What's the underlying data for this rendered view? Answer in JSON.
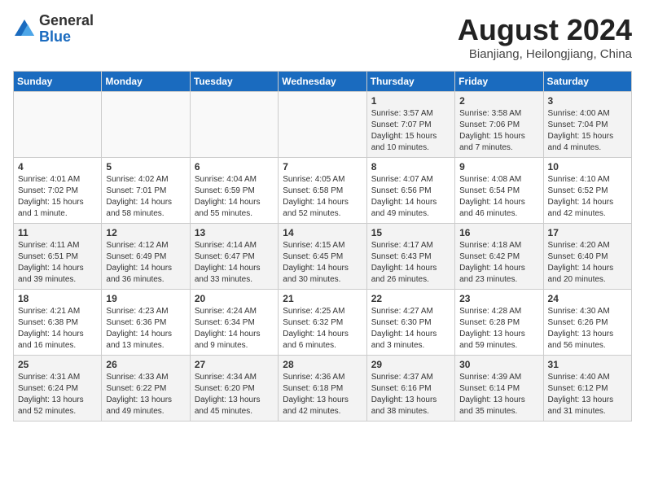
{
  "header": {
    "logo_general": "General",
    "logo_blue": "Blue",
    "title": "August 2024",
    "subtitle": "Bianjiang, Heilongjiang, China"
  },
  "weekdays": [
    "Sunday",
    "Monday",
    "Tuesday",
    "Wednesday",
    "Thursday",
    "Friday",
    "Saturday"
  ],
  "weeks": [
    [
      {
        "day": "",
        "empty": true
      },
      {
        "day": "",
        "empty": true
      },
      {
        "day": "",
        "empty": true
      },
      {
        "day": "",
        "empty": true
      },
      {
        "day": "1",
        "info": "Sunrise: 3:57 AM\nSunset: 7:07 PM\nDaylight: 15 hours\nand 10 minutes."
      },
      {
        "day": "2",
        "info": "Sunrise: 3:58 AM\nSunset: 7:06 PM\nDaylight: 15 hours\nand 7 minutes."
      },
      {
        "day": "3",
        "info": "Sunrise: 4:00 AM\nSunset: 7:04 PM\nDaylight: 15 hours\nand 4 minutes."
      }
    ],
    [
      {
        "day": "4",
        "info": "Sunrise: 4:01 AM\nSunset: 7:02 PM\nDaylight: 15 hours\nand 1 minute."
      },
      {
        "day": "5",
        "info": "Sunrise: 4:02 AM\nSunset: 7:01 PM\nDaylight: 14 hours\nand 58 minutes."
      },
      {
        "day": "6",
        "info": "Sunrise: 4:04 AM\nSunset: 6:59 PM\nDaylight: 14 hours\nand 55 minutes."
      },
      {
        "day": "7",
        "info": "Sunrise: 4:05 AM\nSunset: 6:58 PM\nDaylight: 14 hours\nand 52 minutes."
      },
      {
        "day": "8",
        "info": "Sunrise: 4:07 AM\nSunset: 6:56 PM\nDaylight: 14 hours\nand 49 minutes."
      },
      {
        "day": "9",
        "info": "Sunrise: 4:08 AM\nSunset: 6:54 PM\nDaylight: 14 hours\nand 46 minutes."
      },
      {
        "day": "10",
        "info": "Sunrise: 4:10 AM\nSunset: 6:52 PM\nDaylight: 14 hours\nand 42 minutes."
      }
    ],
    [
      {
        "day": "11",
        "info": "Sunrise: 4:11 AM\nSunset: 6:51 PM\nDaylight: 14 hours\nand 39 minutes."
      },
      {
        "day": "12",
        "info": "Sunrise: 4:12 AM\nSunset: 6:49 PM\nDaylight: 14 hours\nand 36 minutes."
      },
      {
        "day": "13",
        "info": "Sunrise: 4:14 AM\nSunset: 6:47 PM\nDaylight: 14 hours\nand 33 minutes."
      },
      {
        "day": "14",
        "info": "Sunrise: 4:15 AM\nSunset: 6:45 PM\nDaylight: 14 hours\nand 30 minutes."
      },
      {
        "day": "15",
        "info": "Sunrise: 4:17 AM\nSunset: 6:43 PM\nDaylight: 14 hours\nand 26 minutes."
      },
      {
        "day": "16",
        "info": "Sunrise: 4:18 AM\nSunset: 6:42 PM\nDaylight: 14 hours\nand 23 minutes."
      },
      {
        "day": "17",
        "info": "Sunrise: 4:20 AM\nSunset: 6:40 PM\nDaylight: 14 hours\nand 20 minutes."
      }
    ],
    [
      {
        "day": "18",
        "info": "Sunrise: 4:21 AM\nSunset: 6:38 PM\nDaylight: 14 hours\nand 16 minutes."
      },
      {
        "day": "19",
        "info": "Sunrise: 4:23 AM\nSunset: 6:36 PM\nDaylight: 14 hours\nand 13 minutes."
      },
      {
        "day": "20",
        "info": "Sunrise: 4:24 AM\nSunset: 6:34 PM\nDaylight: 14 hours\nand 9 minutes."
      },
      {
        "day": "21",
        "info": "Sunrise: 4:25 AM\nSunset: 6:32 PM\nDaylight: 14 hours\nand 6 minutes."
      },
      {
        "day": "22",
        "info": "Sunrise: 4:27 AM\nSunset: 6:30 PM\nDaylight: 14 hours\nand 3 minutes."
      },
      {
        "day": "23",
        "info": "Sunrise: 4:28 AM\nSunset: 6:28 PM\nDaylight: 13 hours\nand 59 minutes."
      },
      {
        "day": "24",
        "info": "Sunrise: 4:30 AM\nSunset: 6:26 PM\nDaylight: 13 hours\nand 56 minutes."
      }
    ],
    [
      {
        "day": "25",
        "info": "Sunrise: 4:31 AM\nSunset: 6:24 PM\nDaylight: 13 hours\nand 52 minutes."
      },
      {
        "day": "26",
        "info": "Sunrise: 4:33 AM\nSunset: 6:22 PM\nDaylight: 13 hours\nand 49 minutes."
      },
      {
        "day": "27",
        "info": "Sunrise: 4:34 AM\nSunset: 6:20 PM\nDaylight: 13 hours\nand 45 minutes."
      },
      {
        "day": "28",
        "info": "Sunrise: 4:36 AM\nSunset: 6:18 PM\nDaylight: 13 hours\nand 42 minutes."
      },
      {
        "day": "29",
        "info": "Sunrise: 4:37 AM\nSunset: 6:16 PM\nDaylight: 13 hours\nand 38 minutes."
      },
      {
        "day": "30",
        "info": "Sunrise: 4:39 AM\nSunset: 6:14 PM\nDaylight: 13 hours\nand 35 minutes."
      },
      {
        "day": "31",
        "info": "Sunrise: 4:40 AM\nSunset: 6:12 PM\nDaylight: 13 hours\nand 31 minutes."
      }
    ]
  ]
}
